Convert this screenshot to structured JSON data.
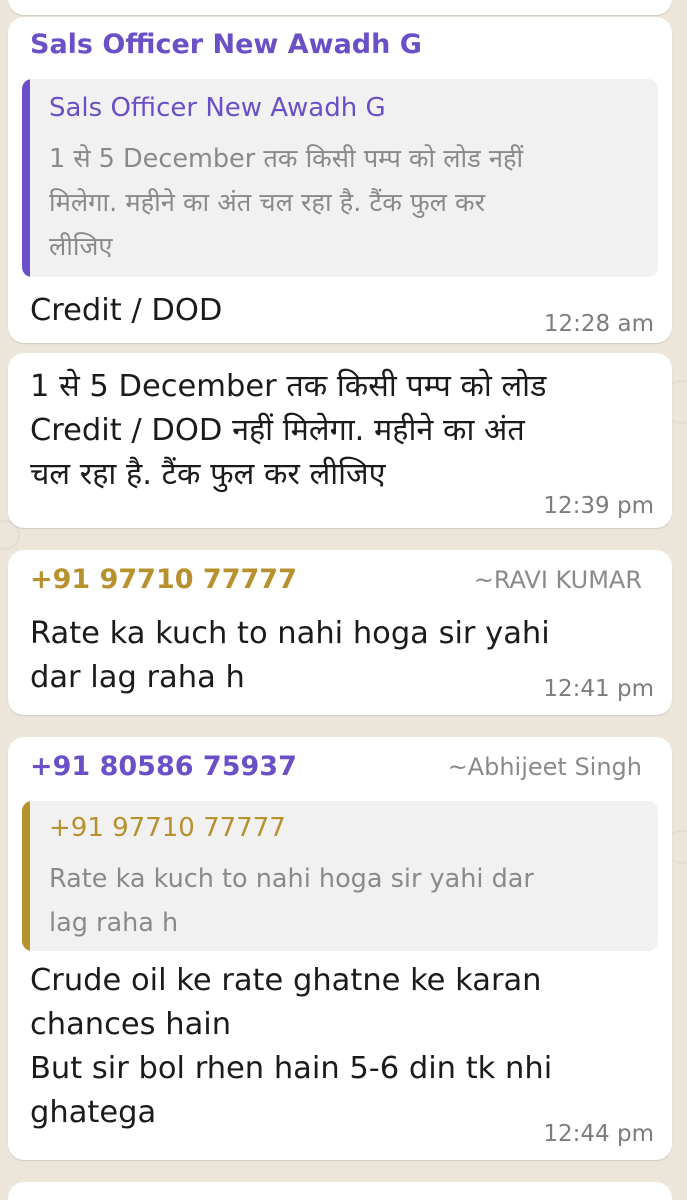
{
  "colors": {
    "chat_background": "#ece5da",
    "bubble": "#ffffff",
    "purple_sender": "#6a4fc6",
    "gold_sender": "#b8912f",
    "quote_background": "#f1f1f1",
    "timestamp": "#7d7d7d"
  },
  "messages": [
    {
      "sender": "Sals Officer New Awadh G",
      "quote": {
        "author": "Sals Officer New Awadh G",
        "lines": [
          "1 से 5 December तक किसी पम्प को लोड नहीं",
          "मिलेगा. महीने का अंत चल रहा है. टैंक फुल कर",
          "लीजिए"
        ]
      },
      "lines": [
        "Credit / DOD"
      ],
      "time": "12:28 am"
    },
    {
      "lines": [
        "1 से 5 December  तक किसी पम्प को लोड",
        "Credit / DOD  नहीं मिलेगा. महीने का अंत",
        "चल रहा है. टैंक फुल कर लीजिए"
      ],
      "time": "12:39 pm"
    },
    {
      "sender": "+91 97710 77777",
      "alias": "~RAVI KUMAR",
      "lines": [
        "Rate ka kuch to nahi hoga sir yahi",
        "dar lag raha h"
      ],
      "time": "12:41 pm"
    },
    {
      "sender": "+91 80586 75937",
      "alias": "~Abhijeet Singh",
      "quote": {
        "author": "+91 97710 77777",
        "lines": [
          "Rate ka kuch to nahi hoga sir yahi dar",
          "lag raha h"
        ]
      },
      "lines": [
        "Crude oil ke rate ghatne ke karan",
        "chances hain",
        "But sir bol rhen hain 5-6 din tk nhi",
        "ghatega"
      ],
      "time": "12:44 pm"
    }
  ]
}
